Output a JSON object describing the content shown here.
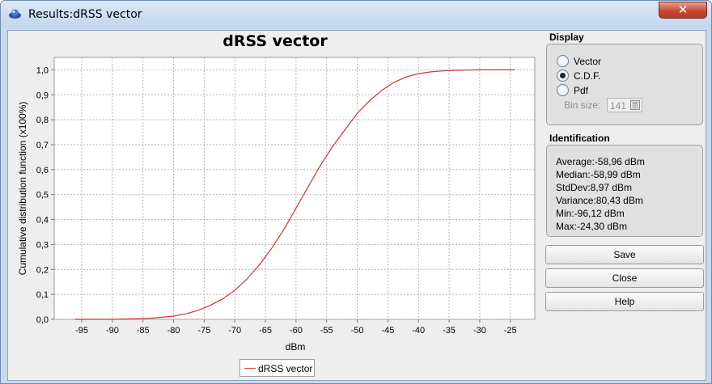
{
  "window": {
    "title": "Results:dRSS vector",
    "close_glyph": "✕"
  },
  "chart_data": {
    "type": "line",
    "title": "dRSS vector",
    "xlabel": "dBm",
    "ylabel": "Cumulative distribution function (x100%)",
    "xlim": [
      -99.5,
      -21
    ],
    "ylim": [
      0,
      1.05
    ],
    "xticks": [
      -95,
      -90,
      -85,
      -80,
      -75,
      -70,
      -65,
      -60,
      -55,
      -50,
      -45,
      -40,
      -35,
      -30,
      -25
    ],
    "yticks": [
      0,
      0.1,
      0.2,
      0.3,
      0.4,
      0.5,
      0.6,
      0.7,
      0.8,
      0.9,
      1.0
    ],
    "ytick_labels": [
      "0,0",
      "0,1",
      "0,2",
      "0,3",
      "0,4",
      "0,5",
      "0,6",
      "0,7",
      "0,8",
      "0,9",
      "1,0"
    ],
    "grid": true,
    "legend_position": "bottom-center",
    "series": [
      {
        "name": "dRSS vector",
        "color": "#cc3333",
        "x": [
          -96.12,
          -90,
          -86,
          -84,
          -82,
          -80,
          -78,
          -76,
          -74,
          -72,
          -70,
          -68,
          -66,
          -64,
          -62,
          -60,
          -58,
          -56,
          -54,
          -52,
          -50,
          -48,
          -46,
          -44,
          -42,
          -40,
          -38,
          -36,
          -34,
          -32,
          -30,
          -28,
          -26,
          -24.3
        ],
        "y": [
          0.0,
          0.0,
          0.002,
          0.004,
          0.008,
          0.013,
          0.022,
          0.036,
          0.056,
          0.082,
          0.116,
          0.162,
          0.218,
          0.284,
          0.36,
          0.446,
          0.532,
          0.618,
          0.694,
          0.76,
          0.826,
          0.876,
          0.918,
          0.95,
          0.972,
          0.985,
          0.992,
          0.996,
          0.998,
          0.999,
          1.0,
          1.0,
          1.0,
          1.0
        ]
      }
    ]
  },
  "display": {
    "title": "Display",
    "options": [
      {
        "label": "Vector",
        "selected": false
      },
      {
        "label": "C.D.F.",
        "selected": true
      },
      {
        "label": "Pdf",
        "selected": false
      }
    ],
    "bin_size_label": "Bin size:",
    "bin_size_value": "141"
  },
  "identification": {
    "title": "Identification",
    "stats": [
      "Average:-58,96 dBm",
      "Median:-58,99 dBm",
      "StdDev:8,97 dBm",
      "Variance:80,43 dBm",
      "Min:-96,12 dBm",
      "Max:-24,30 dBm"
    ]
  },
  "buttons": {
    "save": "Save",
    "close": "Close",
    "help": "Help"
  },
  "colors": {
    "accent": "#cc3333",
    "window_frame": "#c8d9ee"
  }
}
